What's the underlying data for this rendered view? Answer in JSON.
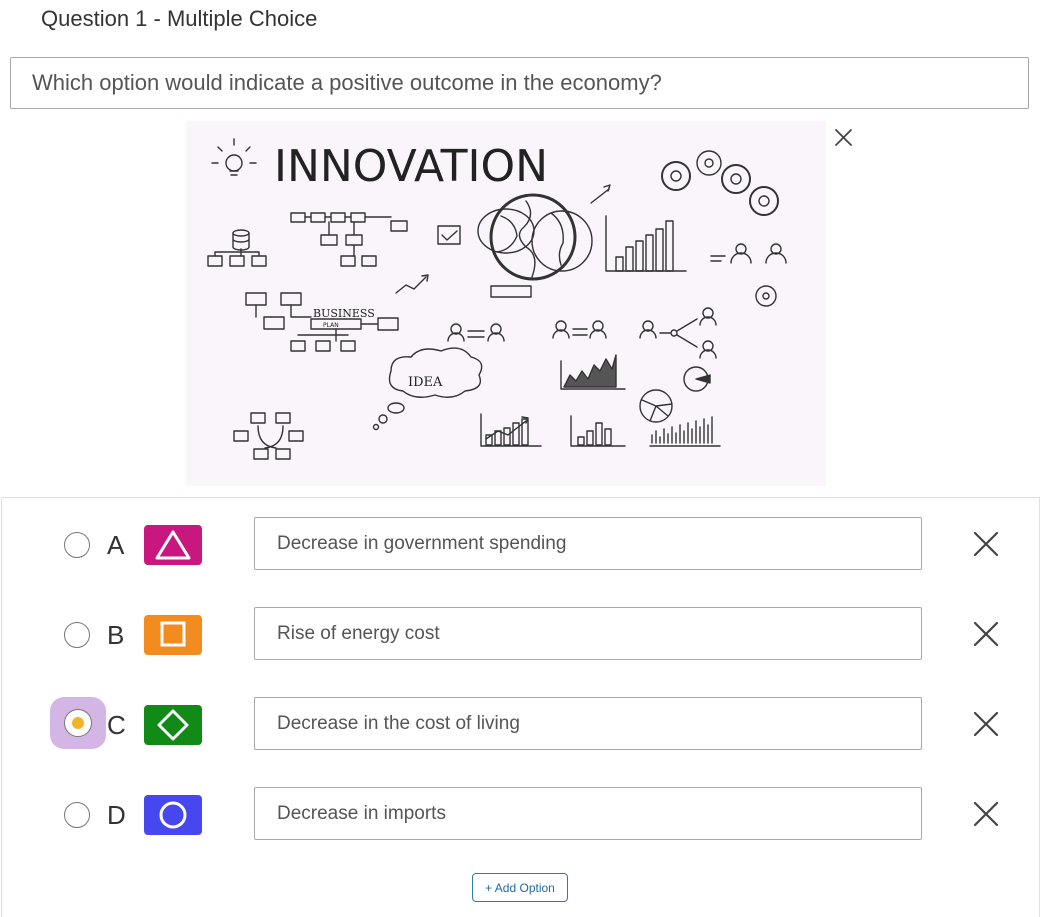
{
  "question": {
    "title": "Question 1 - Multiple Choice",
    "text": "Which option would indicate a positive outcome in the economy?"
  },
  "image": {
    "title_text": "INNOVATION",
    "labels": {
      "business": "BUSINESS",
      "plan": "PLAN",
      "idea": "IDEA"
    },
    "close_icon": "close-icon"
  },
  "options": [
    {
      "letter": "A",
      "text": "Decrease in government spending",
      "shape": "triangle-icon",
      "color": "#c8187f",
      "selected": false
    },
    {
      "letter": "B",
      "text": "Rise of energy cost",
      "shape": "square-icon",
      "color": "#f28c1e",
      "selected": false
    },
    {
      "letter": "C",
      "text": "Decrease in the cost of living",
      "shape": "diamond-icon",
      "color": "#118a17",
      "selected": true
    },
    {
      "letter": "D",
      "text": "Decrease in imports",
      "shape": "circle-icon",
      "color": "#4747f0",
      "selected": false
    }
  ],
  "colors": {
    "selected_highlight": "#d3b6e6",
    "selected_dot": "#f0b429",
    "add_button": "#1d6aa5"
  },
  "add_option_label": "+ Add Option"
}
